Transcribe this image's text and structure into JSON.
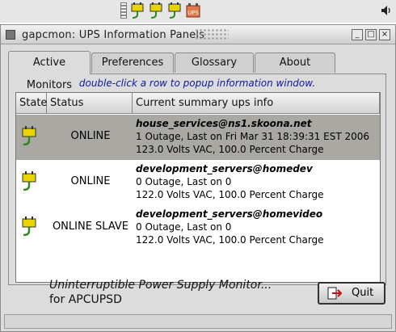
{
  "panel": {
    "icons": [
      "ups-plug-icon",
      "ups-plug-icon",
      "ups-plug-icon",
      "ups-warning-icon"
    ],
    "volume_icon": "speaker-icon"
  },
  "window": {
    "title": "gapcmon: UPS Information Panels",
    "controls": [
      "minimize",
      "maximize",
      "close"
    ]
  },
  "tabs": [
    {
      "label": "Active Monitors",
      "active": true
    },
    {
      "label": "Preferences",
      "active": false
    },
    {
      "label": "Glossary",
      "active": false
    },
    {
      "label": "About",
      "active": false
    }
  ],
  "hint": "double-click a row to popup information window.",
  "table": {
    "columns": [
      "State",
      "Status",
      "Current summary ups info"
    ],
    "rows": [
      {
        "icon": "ups-plug-icon",
        "status": "ONLINE",
        "host": "house_services@ns1.skoona.net",
        "line2": "1 Outage, Last on Fri Mar 31 18:39:31 EST 2006",
        "line3": "123.0 Volts VAC, 100.0 Percent Charge",
        "selected": true
      },
      {
        "icon": "ups-plug-icon",
        "status": "ONLINE",
        "host": "development_servers@homedev",
        "line2": "0 Outage, Last on 0",
        "line3": "122.0 Volts VAC, 100.0 Percent Charge",
        "selected": false
      },
      {
        "icon": "ups-plug-icon",
        "status": "ONLINE SLAVE",
        "host": "development_servers@homevideo",
        "line2": "0 Outage, Last on 0",
        "line3": "122.0 Volts VAC, 100.0 Percent Charge",
        "selected": false
      }
    ]
  },
  "footer": {
    "title": "Uninterruptible Power Supply Monitor...",
    "subtitle": "for APCUPSD",
    "quit_label": "Quit"
  },
  "colors": {
    "hint_text": "#0a1a9c",
    "selected_row": "#aaa8a2",
    "plug_yellow": "#e8d400",
    "plug_green": "#2b8a1c"
  }
}
